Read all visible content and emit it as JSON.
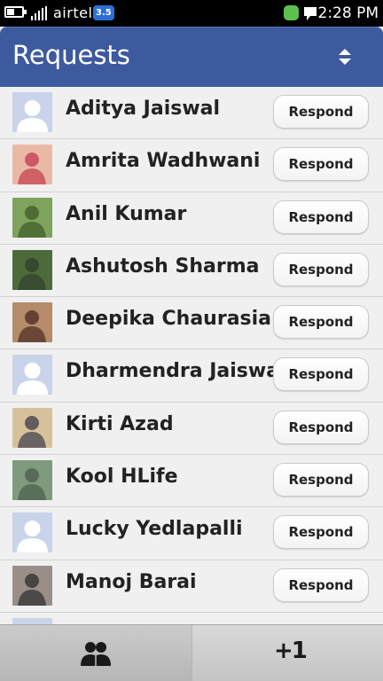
{
  "status_bar": {
    "carrier": "airtel",
    "network": "3.5",
    "time": "2:28 PM"
  },
  "header": {
    "title": "Requests",
    "sort_icon": "sort-updown-icon"
  },
  "requests": [
    {
      "name": "Aditya Jaiswal",
      "button": "Respond",
      "avatar": "placeholder"
    },
    {
      "name": "Amrita Wadhwani",
      "button": "Respond",
      "avatar": "photo"
    },
    {
      "name": "Anil Kumar",
      "button": "Respond",
      "avatar": "photo"
    },
    {
      "name": "Ashutosh Sharma",
      "button": "Respond",
      "avatar": "photo"
    },
    {
      "name": "Deepika Chaurasia",
      "button": "Respond",
      "avatar": "photo"
    },
    {
      "name": "Dharmendra Jaiswal",
      "button": "Respond",
      "avatar": "placeholder"
    },
    {
      "name": "Kirti Azad",
      "button": "Respond",
      "avatar": "photo"
    },
    {
      "name": "Kool HLife",
      "button": "Respond",
      "avatar": "photo"
    },
    {
      "name": "Lucky Yedlapalli",
      "button": "Respond",
      "avatar": "placeholder"
    },
    {
      "name": "Manoj Barai",
      "button": "Respond",
      "avatar": "photo"
    },
    {
      "name": "",
      "button": "",
      "avatar": "placeholder"
    }
  ],
  "toolbar": {
    "requests_icon": "friends-icon",
    "suggest_label": "+1"
  },
  "colors": {
    "header_bg": "#3d5a9e",
    "status_bar_bg": "#000000",
    "list_bg": "#f0f0f0",
    "placeholder_avatar": "#c9d3ea"
  }
}
